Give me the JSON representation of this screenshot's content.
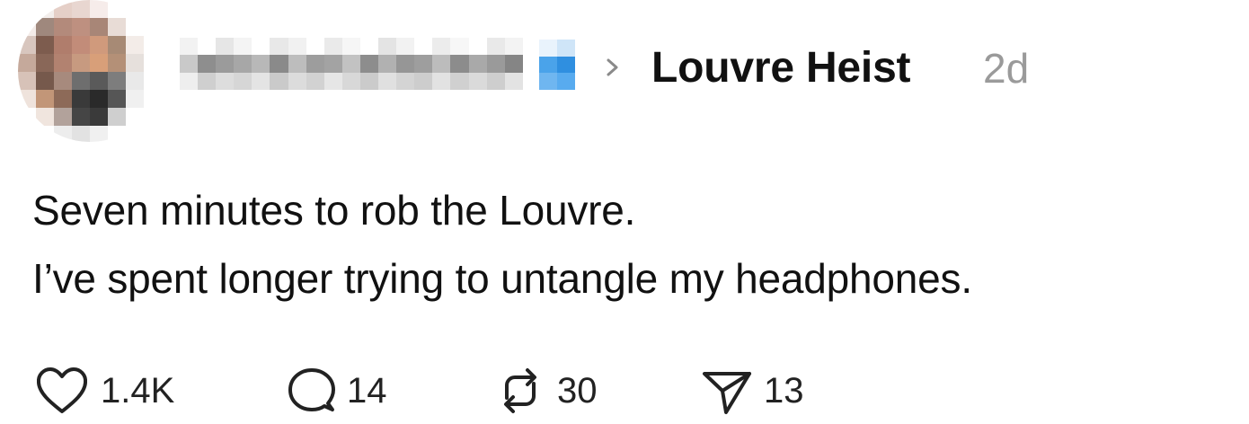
{
  "post": {
    "community": "Louvre Heist",
    "time_ago": "2d",
    "lines": [
      "Seven minutes to rob the Louvre.",
      "I’ve spent longer trying to untangle my headphones."
    ]
  },
  "actions": {
    "likes": "1.4K",
    "replies": "14",
    "reposts": "30",
    "shares": "13"
  },
  "icons": {
    "like": "heart-icon",
    "reply": "speech-bubble-icon",
    "repost": "repost-arrows-icon",
    "share": "paper-plane-icon",
    "separator": "chevron-right-icon"
  },
  "colors": {
    "text": "#111111",
    "muted": "#9a9a9a",
    "verified": "#3d9be9"
  }
}
